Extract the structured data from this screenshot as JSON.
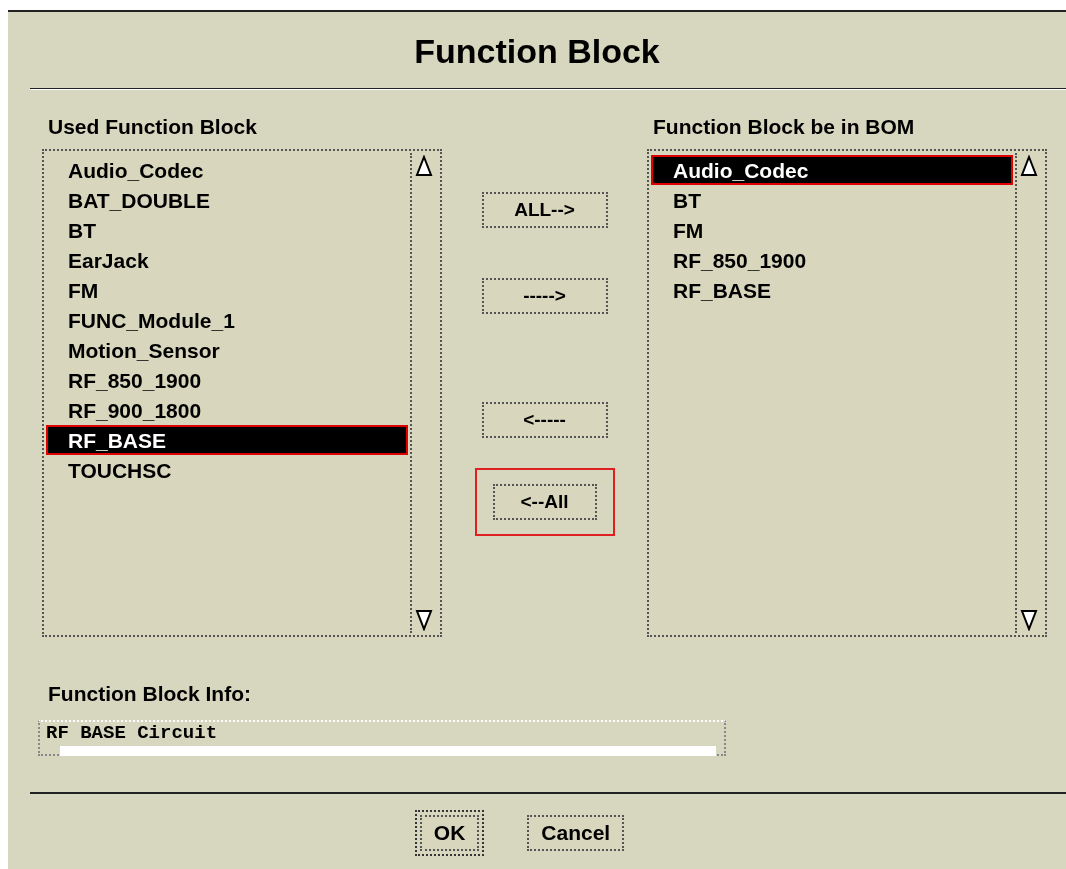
{
  "window": {
    "title": "Function Block"
  },
  "used_list": {
    "label": "Used Function Block",
    "items": [
      {
        "label": "Audio_Codec",
        "selected": false
      },
      {
        "label": "BAT_DOUBLE",
        "selected": false
      },
      {
        "label": "BT",
        "selected": false
      },
      {
        "label": "EarJack",
        "selected": false
      },
      {
        "label": "FM",
        "selected": false
      },
      {
        "label": "FUNC_Module_1",
        "selected": false
      },
      {
        "label": "Motion_Sensor",
        "selected": false
      },
      {
        "label": "RF_850_1900",
        "selected": false
      },
      {
        "label": "RF_900_1800",
        "selected": false
      },
      {
        "label": "RF_BASE",
        "selected": true
      },
      {
        "label": "TOUCHSC",
        "selected": false
      }
    ]
  },
  "move_buttons": [
    {
      "label": "ALL-->",
      "highlighted": false
    },
    {
      "label": "----->",
      "highlighted": false
    },
    {
      "label": "<-----",
      "highlighted": false
    },
    {
      "label": "<--All",
      "highlighted": true
    }
  ],
  "bom_list": {
    "label": "Function Block be in BOM",
    "items": [
      {
        "label": "Audio_Codec",
        "selected": true
      },
      {
        "label": "BT",
        "selected": false
      },
      {
        "label": "FM",
        "selected": false
      },
      {
        "label": "RF_850_1900",
        "selected": false
      },
      {
        "label": "RF_BASE",
        "selected": false
      }
    ]
  },
  "info": {
    "label": "Function Block Info:",
    "value": "RF BASE Circuit"
  },
  "footer_buttons": [
    {
      "label": "OK",
      "default": true
    },
    {
      "label": "Cancel",
      "default": false
    }
  ]
}
